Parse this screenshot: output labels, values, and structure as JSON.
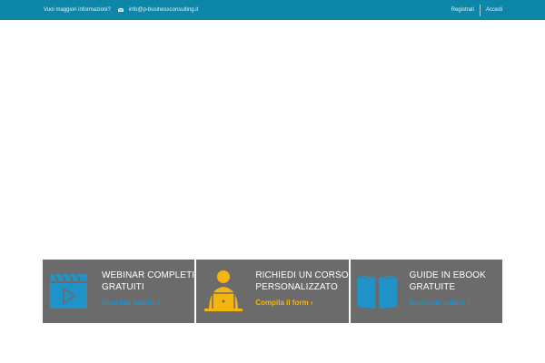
{
  "topbar": {
    "info_label": "Vuoi maggiori informazioni?",
    "email": "info@p-businessconsulting.it",
    "register_label": "Registrati",
    "login_label": "Accedi",
    "icons": [
      "mail-icon"
    ]
  },
  "cards": [
    {
      "title_line1": "WEBINAR COMPLETI",
      "title_line2": "GRATUITI",
      "cta": "Guardali subito ›",
      "icon": "video-clapper-icon",
      "accent": "#1f92c7"
    },
    {
      "title_line1": "RICHIEDI UN CORSO",
      "title_line2": "PERSONALIZZATO",
      "cta": "Compila il form ›",
      "icon": "person-laptop-icon",
      "accent": "#f5b50f"
    },
    {
      "title_line1": "GUIDE IN EBOOK",
      "title_line2": "GRATUITE",
      "cta": "Scaricale subito ›",
      "icon": "open-book-icon",
      "accent": "#1f92c7"
    }
  ],
  "colors": {
    "topbar": "#0e86a8",
    "card_bg": "#6b6b6b",
    "blue": "#1f92c7",
    "yellow": "#f5b50f"
  }
}
